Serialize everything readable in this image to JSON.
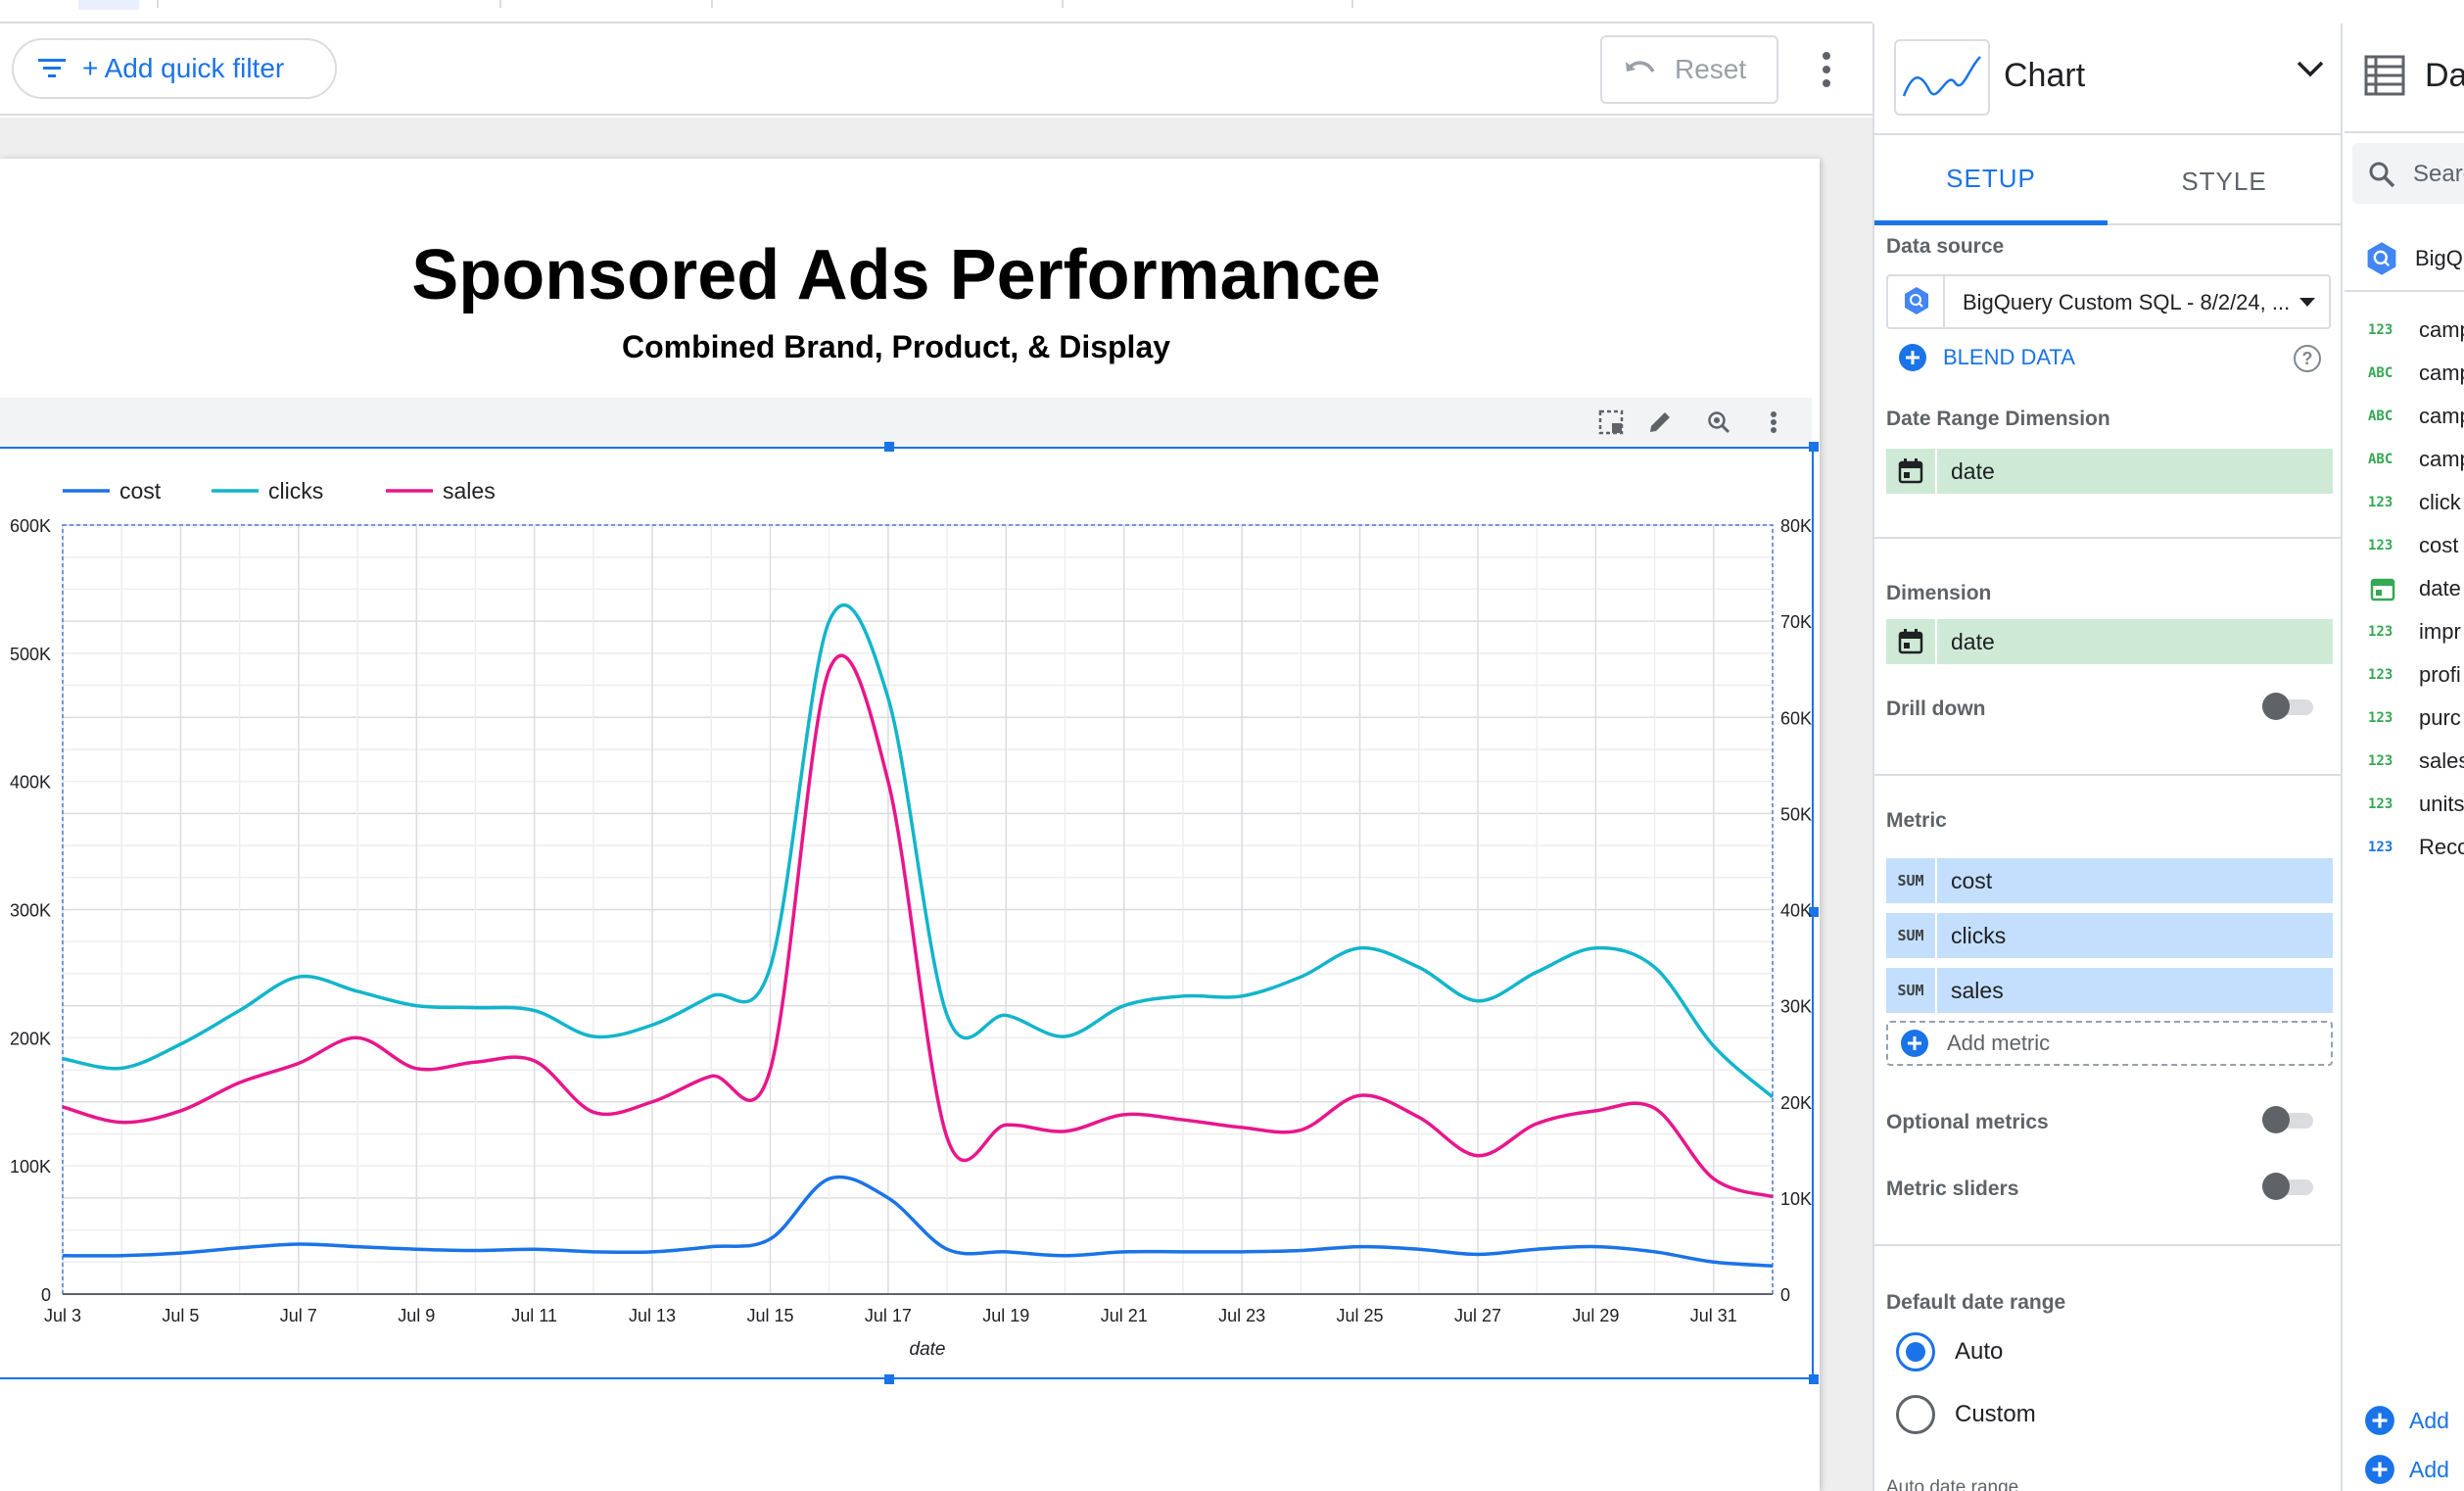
{
  "toolbar": {
    "quick_filter_label": "+ Add quick filter",
    "reset_label": "Reset"
  },
  "report": {
    "title": "Sponsored Ads Performance",
    "subtitle": "Combined Brand, Product, & Display"
  },
  "chart_data": {
    "type": "line",
    "title": "",
    "xlabel": "date",
    "ylabel_left": "",
    "ylabel_right": "",
    "legend_position": "top-left",
    "grid": true,
    "smooth": true,
    "x": [
      "Jul 3",
      "Jul 4",
      "Jul 5",
      "Jul 6",
      "Jul 7",
      "Jul 8",
      "Jul 9",
      "Jul 10",
      "Jul 11",
      "Jul 12",
      "Jul 13",
      "Jul 14",
      "Jul 15",
      "Jul 16",
      "Jul 17",
      "Jul 18",
      "Jul 19",
      "Jul 20",
      "Jul 21",
      "Jul 22",
      "Jul 23",
      "Jul 24",
      "Jul 25",
      "Jul 26",
      "Jul 27",
      "Jul 28",
      "Jul 29",
      "Jul 30",
      "Jul 31",
      "Aug 1"
    ],
    "x_tick_labels": [
      "Jul 3",
      "Jul 5",
      "Jul 7",
      "Jul 9",
      "Jul 11",
      "Jul 13",
      "Jul 15",
      "Jul 17",
      "Jul 19",
      "Jul 21",
      "Jul 23",
      "Jul 25",
      "Jul 27",
      "Jul 29",
      "Jul 31"
    ],
    "y_left": {
      "range": [
        0,
        600000
      ],
      "ticks": [
        "0",
        "100K",
        "200K",
        "300K",
        "400K",
        "500K",
        "600K"
      ]
    },
    "y_right": {
      "range": [
        0,
        80000
      ],
      "ticks": [
        "0",
        "10K",
        "20K",
        "30K",
        "40K",
        "50K",
        "60K",
        "70K",
        "80K"
      ]
    },
    "series": [
      {
        "name": "cost",
        "color": "#1a73e8",
        "axis": "left",
        "values": [
          30000,
          30000,
          32000,
          36000,
          39000,
          37000,
          35000,
          34000,
          35000,
          33000,
          33000,
          37000,
          43000,
          90000,
          75000,
          35000,
          33000,
          30000,
          33000,
          33000,
          33000,
          34000,
          37000,
          35000,
          31000,
          35000,
          37000,
          33000,
          25000,
          22000
        ]
      },
      {
        "name": "clicks",
        "color": "#12b5cb",
        "axis": "right",
        "values": [
          24500,
          23500,
          26000,
          29500,
          33000,
          31500,
          30000,
          29800,
          29500,
          26800,
          28000,
          31000,
          34000,
          70000,
          62000,
          29000,
          29000,
          26800,
          30000,
          31000,
          31000,
          33000,
          36000,
          34000,
          30500,
          33500,
          36000,
          34000,
          25800,
          20500
        ]
      },
      {
        "name": "sales",
        "color": "#e8168b",
        "axis": "left",
        "values": [
          146000,
          134000,
          143000,
          165000,
          180000,
          200000,
          176000,
          181000,
          182000,
          142000,
          150000,
          170000,
          175000,
          487000,
          400000,
          122000,
          132000,
          127000,
          140000,
          136000,
          130000,
          128000,
          155000,
          138000,
          108000,
          133000,
          143000,
          145000,
          90000,
          76000
        ]
      }
    ]
  },
  "panel": {
    "chart_type": "Chart",
    "tabs": [
      "SETUP",
      "STYLE"
    ],
    "data_source_label": "Data source",
    "data_source_value": "BigQuery Custom SQL - 8/2/24, ...",
    "blend_label": "BLEND DATA",
    "help_glyph": "?",
    "date_range_label": "Date Range Dimension",
    "date_range_field": "date",
    "dimension_label": "Dimension",
    "dimension_field": "date",
    "drill_down_label": "Drill down",
    "metric_label": "Metric",
    "metric_agg": "SUM",
    "metrics": [
      "cost",
      "clicks",
      "sales"
    ],
    "add_metric_label": "Add metric",
    "optional_metrics_label": "Optional metrics",
    "metric_sliders_label": "Metric sliders",
    "default_date_label": "Default date range",
    "date_options": [
      "Auto",
      "Custom"
    ],
    "auto_date_label": "Auto date range"
  },
  "data_panel": {
    "title": "Da",
    "search_placeholder": "Searc",
    "source": "BigQu",
    "fields": [
      {
        "type": "123",
        "name": "camp"
      },
      {
        "type": "ABC",
        "name": "camp"
      },
      {
        "type": "ABC",
        "name": "camp"
      },
      {
        "type": "ABC",
        "name": "camp"
      },
      {
        "type": "123",
        "name": "click"
      },
      {
        "type": "123",
        "name": "cost"
      },
      {
        "type": "date",
        "name": "date"
      },
      {
        "type": "123",
        "name": "impr"
      },
      {
        "type": "123",
        "name": "profi"
      },
      {
        "type": "123",
        "name": "purc"
      },
      {
        "type": "123",
        "name": "sales"
      },
      {
        "type": "123",
        "name": "units"
      },
      {
        "type": "123",
        "name": "Reco"
      }
    ],
    "add_labels": [
      "Add",
      "Add"
    ]
  }
}
